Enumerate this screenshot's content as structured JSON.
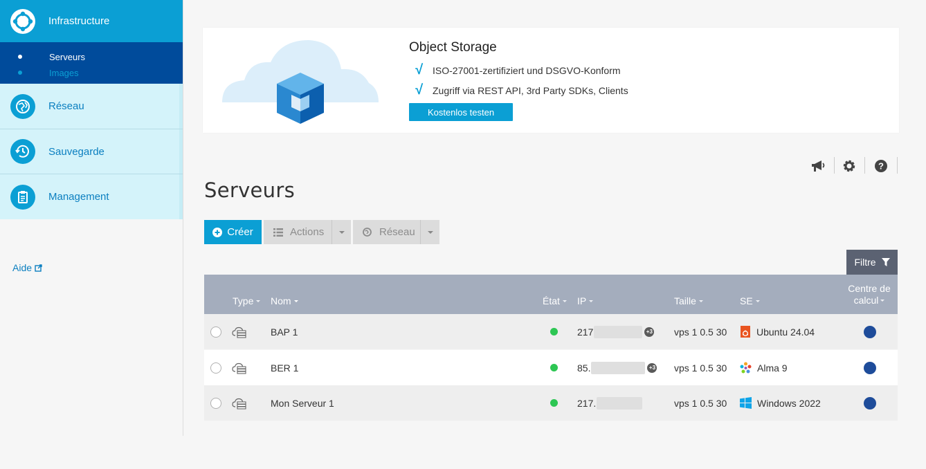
{
  "sidebar": {
    "infrastructure": "Infrastructure",
    "sub_items": [
      "Serveurs",
      "Images"
    ],
    "reseau": "Réseau",
    "sauvegarde": "Sauvegarde",
    "management": "Management",
    "aide": "Aide"
  },
  "banner": {
    "title": "Object Storage",
    "features": [
      "ISO-27001-zertifiziert und DSGVO-Konform",
      "Zugriff via REST API, 3rd Party SDKs, Clients"
    ],
    "button": "Kostenlos testen"
  },
  "page": {
    "title": "Serveurs"
  },
  "toolbar": {
    "create": "Créer",
    "actions": "Actions",
    "reseau": "Réseau",
    "filter": "Filtre"
  },
  "table": {
    "headers": {
      "type": "Type",
      "nom": "Nom",
      "etat": "État",
      "ip": "IP",
      "taille": "Taille",
      "se": "SE",
      "dc_line1": "Centre de",
      "dc_line2": "calcul"
    },
    "rows": [
      {
        "nom": "BAP 1",
        "ip": "217",
        "extra_ips": "+3",
        "taille": "vps 1 0.5 30",
        "se": "Ubuntu 24.04",
        "se_icon": "ubuntu-icon"
      },
      {
        "nom": "BER 1",
        "ip": "85.",
        "extra_ips": "+3",
        "taille": "vps 1 0.5 30",
        "se": "Alma 9",
        "se_icon": "alma-icon"
      },
      {
        "nom": "Mon Serveur 1",
        "ip": "217.",
        "extra_ips": "",
        "taille": "vps 1 0.5 30",
        "se": "Windows 2022",
        "se_icon": "windows-icon"
      }
    ]
  },
  "colors": {
    "accent": "#0b9fd4",
    "nav_dark": "#004b9b",
    "nav_light": "#d4f3fa",
    "table_header": "#a4adbd",
    "status_ok": "#2dc653"
  }
}
